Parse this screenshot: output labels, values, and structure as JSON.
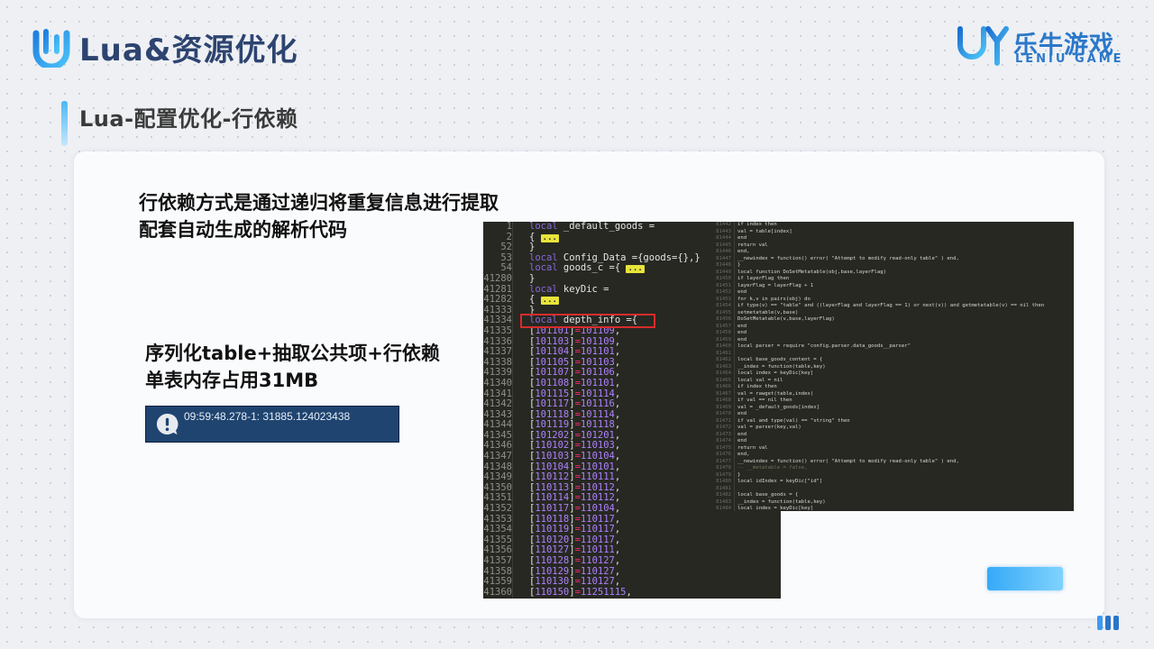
{
  "header": {
    "title": "Lua&资源优化",
    "brand_cn": "乐牛游戏",
    "brand_en": "LENIU GAME"
  },
  "section": {
    "title": "Lua-配置优化-行依赖"
  },
  "description": {
    "line1": "行依赖方式是通过递归将重复信息进行提取",
    "line2": "配套自动生成的解析代码"
  },
  "result": {
    "line1": "序列化table+抽取公共项+行依赖",
    "line2": "单表内存占用31MB"
  },
  "memory_log": {
    "icon": "alert-icon",
    "text": "09:59:48.278-1: 31885.124023438"
  },
  "code_left": {
    "lines": [
      {
        "n": "1",
        "kw": "local",
        "rest": " _default_goods ="
      },
      {
        "n": "2",
        "rest": "{",
        "fold": "..."
      },
      {
        "n": "52",
        "rest": "}"
      },
      {
        "n": "53",
        "kw": "local",
        "rest": " Config_Data ={goods={},}"
      },
      {
        "n": "54",
        "kw": "local",
        "rest": " goods_c ={",
        "fold": "..."
      },
      {
        "n": "41280",
        "rest": "}"
      },
      {
        "n": "41281",
        "kw": "local",
        "rest": " keyDic ="
      },
      {
        "n": "41282",
        "rest": "{",
        "fold": "..."
      },
      {
        "n": "41333",
        "rest": "}"
      },
      {
        "n": "41334",
        "kw": "local",
        "rest": " depth_info ={"
      },
      {
        "n": "41335",
        "rest": "    [101101]=101109,"
      },
      {
        "n": "41336",
        "rest": "    [101103]=101109,"
      },
      {
        "n": "41337",
        "rest": "    [101104]=101101,"
      },
      {
        "n": "41338",
        "rest": "    [101105]=101103,"
      },
      {
        "n": "41339",
        "rest": "    [101107]=101106,"
      },
      {
        "n": "41340",
        "rest": "    [101108]=101101,"
      },
      {
        "n": "41341",
        "rest": "    [101115]=101114,"
      },
      {
        "n": "41342",
        "rest": "    [101117]=101116,"
      },
      {
        "n": "41343",
        "rest": "    [101118]=101114,"
      },
      {
        "n": "41344",
        "rest": "    [101119]=101118,"
      },
      {
        "n": "41345",
        "rest": "    [101202]=101201,"
      },
      {
        "n": "41346",
        "rest": "    [110102]=110103,"
      },
      {
        "n": "41347",
        "rest": "    [110103]=110104,"
      },
      {
        "n": "41348",
        "rest": "    [110104]=110101,"
      },
      {
        "n": "41349",
        "rest": "    [110112]=110111,"
      },
      {
        "n": "41350",
        "rest": "    [110113]=110112,"
      },
      {
        "n": "41351",
        "rest": "    [110114]=110112,"
      },
      {
        "n": "41352",
        "rest": "    [110117]=110104,"
      },
      {
        "n": "41353",
        "rest": "    [110118]=110117,"
      },
      {
        "n": "41354",
        "rest": "    [110119]=110117,"
      },
      {
        "n": "41355",
        "rest": "    [110120]=110117,"
      },
      {
        "n": "41356",
        "rest": "    [110127]=110111,"
      },
      {
        "n": "41357",
        "rest": "    [110128]=110127,"
      },
      {
        "n": "41358",
        "rest": "    [110129]=110127,"
      },
      {
        "n": "41359",
        "rest": "    [110130]=110127,"
      },
      {
        "n": "41360",
        "rest": "    [110150]=11251115,"
      }
    ]
  },
  "code_right": {
    "lines": [
      {
        "n": "81442",
        "t": "            if index then"
      },
      {
        "n": "81443",
        "t": "                val = table[index]"
      },
      {
        "n": "81444",
        "t": "            end"
      },
      {
        "n": "81445",
        "t": "            return val"
      },
      {
        "n": "81446",
        "t": "        end,"
      },
      {
        "n": "81447",
        "t": "        __newindex = function() error( \"Attempt to modify read-only table\" ) end,"
      },
      {
        "n": "81448",
        "t": "}"
      },
      {
        "n": "81449",
        "t": "local function DoSetMetatable(obj,base,layerFlag)"
      },
      {
        "n": "81450",
        "t": "    if layerFlag then"
      },
      {
        "n": "81451",
        "t": "        layerFlag = layerFlag + 1"
      },
      {
        "n": "81452",
        "t": "    end"
      },
      {
        "n": "81453",
        "t": "    for k,v in pairs(obj) do"
      },
      {
        "n": "81454",
        "t": "        if type(v) == \"table\" and ((layerFlag and layerFlag == 1) or next(v)) and getmetatable(v) == nil then"
      },
      {
        "n": "81455",
        "t": "            setmetatable(v,base)"
      },
      {
        "n": "81456",
        "t": "            DoSetMetatable(v,base,layerFlag)"
      },
      {
        "n": "81457",
        "t": "        end"
      },
      {
        "n": "81458",
        "t": "    end"
      },
      {
        "n": "81459",
        "t": "end"
      },
      {
        "n": "81460",
        "t": "local parser = require \"config.parser.data_goods__parser\""
      },
      {
        "n": "81461",
        "t": ""
      },
      {
        "n": "81462",
        "t": "local base_goods_content = {"
      },
      {
        "n": "81463",
        "t": "    __index = function(table,key)"
      },
      {
        "n": "81464",
        "t": "        local index = keyDic[key]"
      },
      {
        "n": "81465",
        "t": "        local val = nil"
      },
      {
        "n": "81466",
        "t": "        if index then"
      },
      {
        "n": "81467",
        "t": "            val = rawget(table,index)"
      },
      {
        "n": "81468",
        "t": "            if val == nil then"
      },
      {
        "n": "81469",
        "t": "                val = _default_goods[index]"
      },
      {
        "n": "81470",
        "t": "            end"
      },
      {
        "n": "81471",
        "t": "            if val and type(val) == \"string\" then"
      },
      {
        "n": "81472",
        "t": "                val = parser(key,val)"
      },
      {
        "n": "81473",
        "t": "            end"
      },
      {
        "n": "81474",
        "t": "        end"
      },
      {
        "n": "81475",
        "t": "        return val"
      },
      {
        "n": "81476",
        "t": "    end,"
      },
      {
        "n": "81477",
        "t": "    __newindex = function() error( \"Attempt to modify read-only table\" ) end,"
      },
      {
        "n": "81478",
        "t": "    -- __metatable = false,"
      },
      {
        "n": "81479",
        "t": "}"
      },
      {
        "n": "81480",
        "t": "local idIndex = keyDic[\"id\"]"
      },
      {
        "n": "81481",
        "t": ""
      },
      {
        "n": "81482",
        "t": "local base_goods = {"
      },
      {
        "n": "81483",
        "t": "    __index = function(table,key)"
      },
      {
        "n": "81484",
        "t": "        local index = keyDic[key]"
      }
    ]
  }
}
